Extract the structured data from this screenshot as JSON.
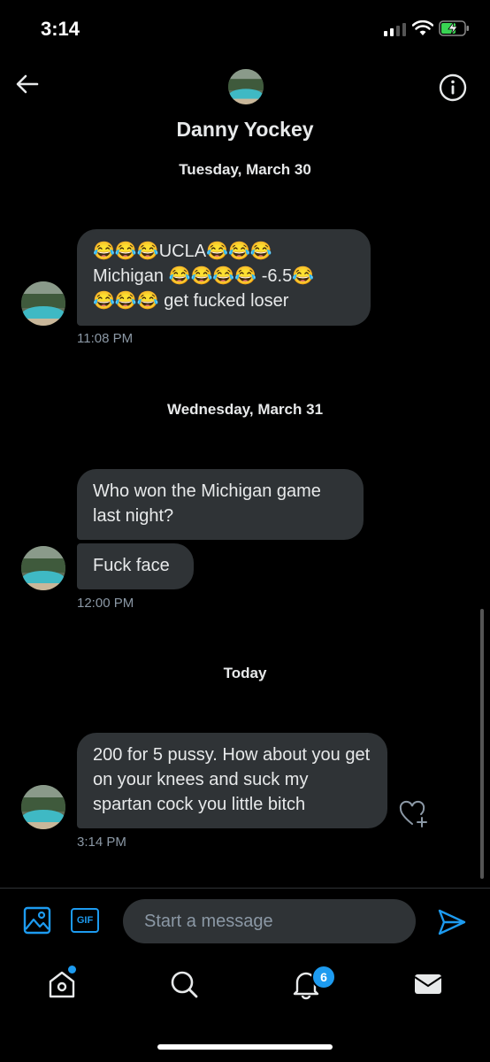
{
  "status_bar": {
    "time": "3:14"
  },
  "header": {
    "title": "Danny Yockey"
  },
  "conversation": {
    "groups": [
      {
        "date": "Tuesday, March 30",
        "messages": [
          {
            "lines": [
              "😂😂😂UCLA😂😂😂",
              "Michigan 😂😂😂😂 -6.5😂",
              "😂😂😂 get fucked loser"
            ],
            "time": "11:08 PM"
          }
        ]
      },
      {
        "date": "Wednesday, March 31",
        "messages": [
          {
            "text": "Who won the Michigan game last night?"
          },
          {
            "text": "Fuck face",
            "time": "12:00 PM"
          }
        ]
      },
      {
        "date": "Today",
        "messages": [
          {
            "text": "200 for 5 pussy. How about you get on your knees and suck my spartan cock you little bitch",
            "time": "3:14 PM"
          }
        ]
      }
    ]
  },
  "composer": {
    "gif_label": "GIF",
    "placeholder": "Start a message"
  },
  "tab_bar": {
    "notifications_badge": "6"
  },
  "colors": {
    "accent": "#1d9bf0",
    "bubble": "#2f3336",
    "background": "#000000"
  },
  "icons": [
    "back-arrow-icon",
    "info-icon",
    "image-icon",
    "send-icon",
    "heart-plus-icon",
    "home-icon",
    "search-icon",
    "bell-icon",
    "mail-icon"
  ]
}
